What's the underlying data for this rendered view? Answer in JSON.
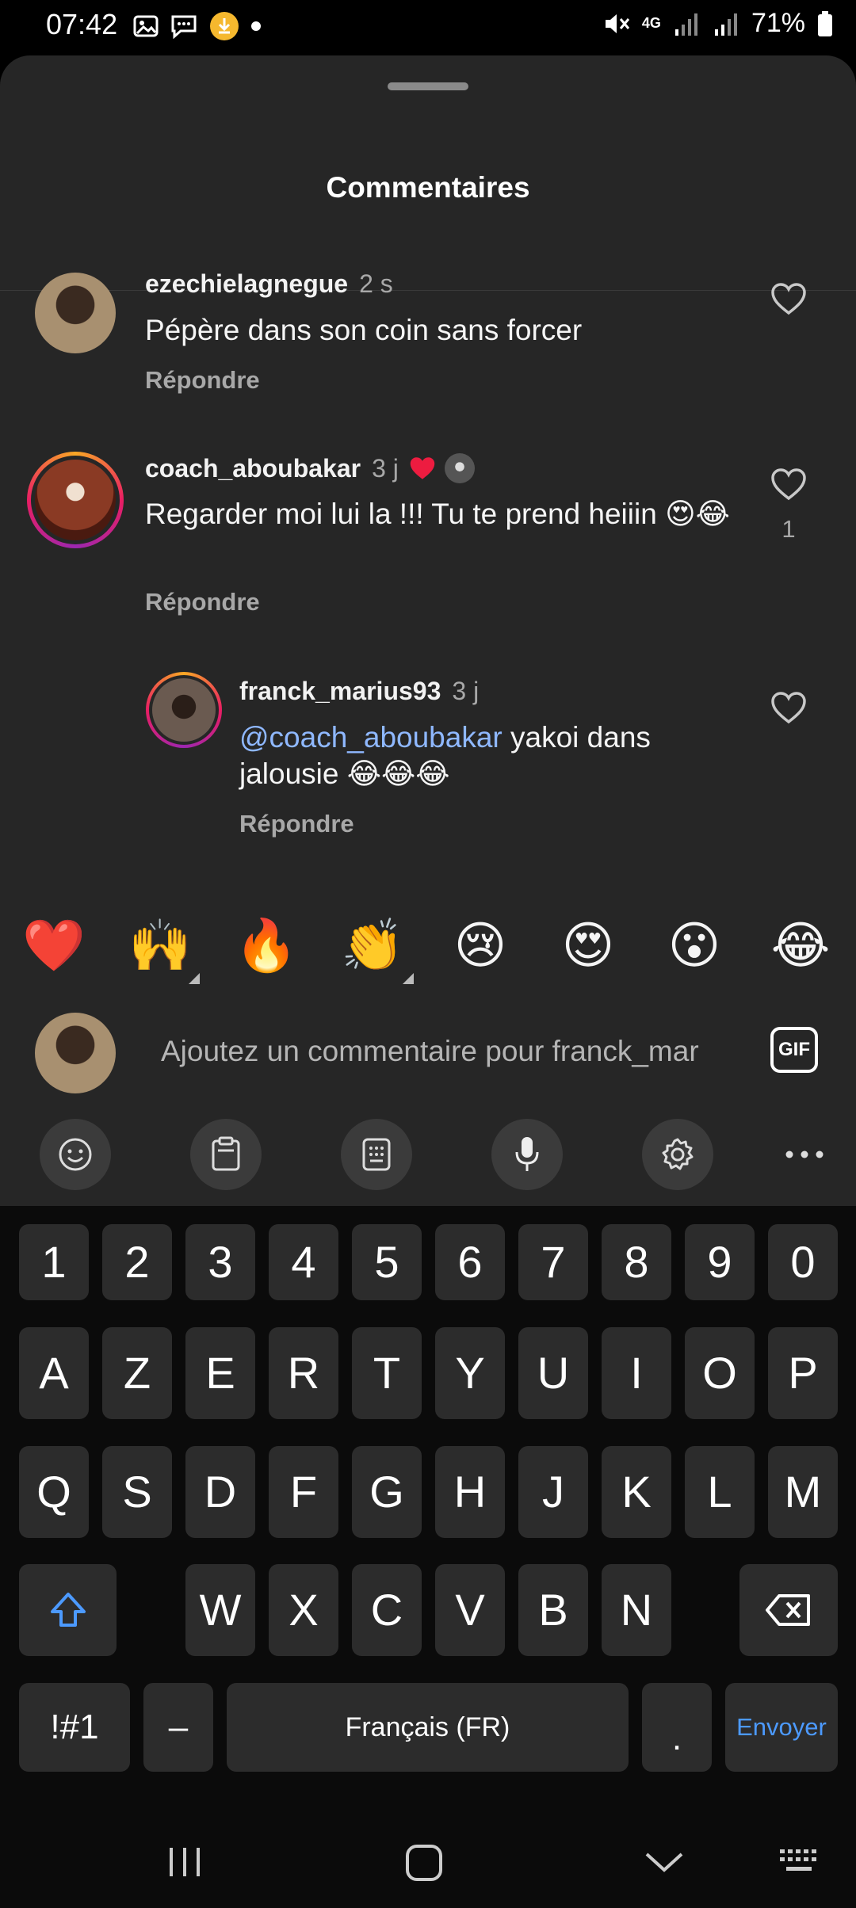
{
  "status_bar": {
    "time": "07:42",
    "network": "4G",
    "battery": "71%"
  },
  "sheet": {
    "title": "Commentaires"
  },
  "comments": [
    {
      "username": "ezechielagnegue",
      "time": "2 s",
      "text": "Pépère dans son coin sans forcer",
      "reply_label": "Répondre",
      "avatar_color": "#6b5a47"
    },
    {
      "username": "coach_aboubakar",
      "time": "3 j",
      "text": "Regarder moi lui la !!! Tu te prend heiiin 😍😂",
      "reply_label": "Répondre",
      "likes": "1",
      "avatar_color": "#7a2a1c"
    },
    {
      "username": "franck_marius93",
      "time": "3 j",
      "mention": "@coach_aboubakar",
      "text": " yakoi dans jalousie 😂😂😂",
      "reply_label": "Répondre",
      "avatar_color": "#4a3b34"
    }
  ],
  "emoji_bar": [
    "❤️",
    "🙌",
    "🔥",
    "👏",
    "😢",
    "😍",
    "😮",
    "😂"
  ],
  "comment_input": {
    "placeholder": "Ajoutez un commentaire pour franck_mar",
    "gif_label": "GIF"
  },
  "keyboard_toolbar": [
    "emoji-icon",
    "clipboard-icon",
    "keypad-icon",
    "microphone-icon",
    "settings-icon",
    "more-icon"
  ],
  "keyboard": {
    "number_row": [
      "1",
      "2",
      "3",
      "4",
      "5",
      "6",
      "7",
      "8",
      "9",
      "0"
    ],
    "row1": [
      "A",
      "Z",
      "E",
      "R",
      "T",
      "Y",
      "U",
      "I",
      "O",
      "P"
    ],
    "row2": [
      "Q",
      "S",
      "D",
      "F",
      "G",
      "H",
      "J",
      "K",
      "L",
      "M"
    ],
    "row3": [
      "W",
      "X",
      "C",
      "V",
      "B",
      "N"
    ],
    "symbols_label": "!#1",
    "dash_label": "–",
    "space_label": "Français (FR)",
    "period_label": ".",
    "send_label": "Envoyer"
  },
  "colors": {
    "accent": "#4c9aff",
    "like_heart": "#ed1c40",
    "sheet_bg": "#262626"
  }
}
